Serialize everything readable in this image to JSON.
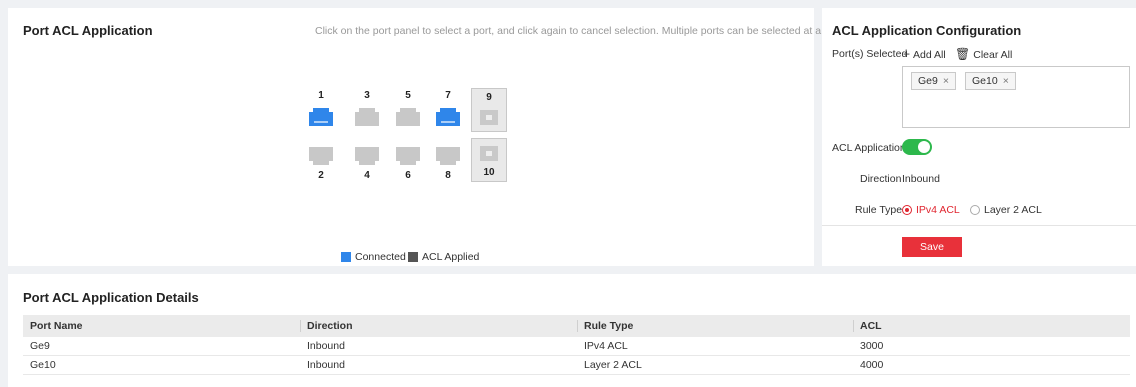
{
  "port_panel": {
    "title": "Port ACL Application",
    "hint": "Click on the port panel to select a port, and click again to cancel selection. Multiple ports can be selected at a time.",
    "ports": [
      {
        "num": "1",
        "state": "connected"
      },
      {
        "num": "2",
        "state": "disconnected"
      },
      {
        "num": "3",
        "state": "disconnected"
      },
      {
        "num": "4",
        "state": "disconnected"
      },
      {
        "num": "5",
        "state": "disconnected"
      },
      {
        "num": "6",
        "state": "disconnected"
      },
      {
        "num": "7",
        "state": "connected"
      },
      {
        "num": "8",
        "state": "disconnected"
      },
      {
        "num": "9",
        "state": "acl_applied"
      },
      {
        "num": "10",
        "state": "acl_applied"
      }
    ],
    "legend": {
      "connected": "Connected",
      "acl_applied": "ACL Applied"
    }
  },
  "config": {
    "title": "ACL Application Configuration",
    "ports_selected_label": "Port(s) Selected",
    "add_all": "Add All",
    "clear_all": "Clear All",
    "selected_ports": [
      "Ge9",
      "Ge10"
    ],
    "acl_application_label": "ACL Application",
    "acl_application_on": true,
    "direction_label": "Direction",
    "direction_value": "Inbound",
    "rule_type_label": "Rule Type",
    "rule_type_options": [
      "IPv4 ACL",
      "Layer 2 ACL"
    ],
    "rule_type_selected": "IPv4 ACL",
    "save": "Save"
  },
  "details": {
    "title": "Port ACL Application Details",
    "columns": [
      "Port Name",
      "Direction",
      "Rule Type",
      "ACL"
    ],
    "rows": [
      [
        "Ge9",
        "Inbound",
        "IPv4 ACL",
        "3000"
      ],
      [
        "Ge10",
        "Inbound",
        "Layer 2 ACL",
        "4000"
      ]
    ]
  },
  "colors": {
    "connected": "#2f86ea",
    "disconnected": "#c8c8c8",
    "acl_applied": "#555555",
    "accent_red": "#e8313a",
    "toggle_on": "#2db84c"
  }
}
